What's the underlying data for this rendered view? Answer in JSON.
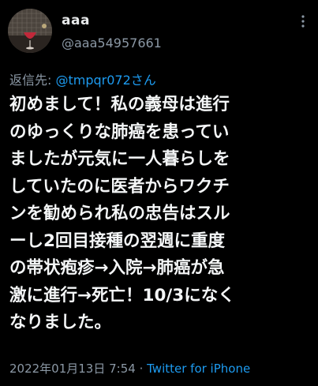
{
  "tweet": {
    "display_name": "aaa",
    "handle": "@aaa54957661",
    "reply_prefix": "返信先: ",
    "reply_mention": "@tmpqr072さん",
    "body_lines": [
      "初めまして！私の義母は進行",
      "のゆっくりな肺癌を患ってい",
      "ましたが元気に一人暮らしを",
      "していたのに医者からワクチ",
      "ンを勧められ私の忠告はスル",
      "ーし2回目接種の翌週に重度",
      "の帯状疱疹→入院→肺癌が急",
      "激に進行→死亡！10/3になく",
      "なりました。"
    ],
    "timestamp": "2022年01月13日 7:54",
    "separator": " · ",
    "source": "Twitter for iPhone"
  },
  "icons": {
    "avatar": "avatar-photo",
    "more": "more-options-icon"
  },
  "colors": {
    "background": "#000000",
    "text": "#e7e9ea",
    "secondary": "#8b98a5",
    "link": "#1d9bf0"
  }
}
